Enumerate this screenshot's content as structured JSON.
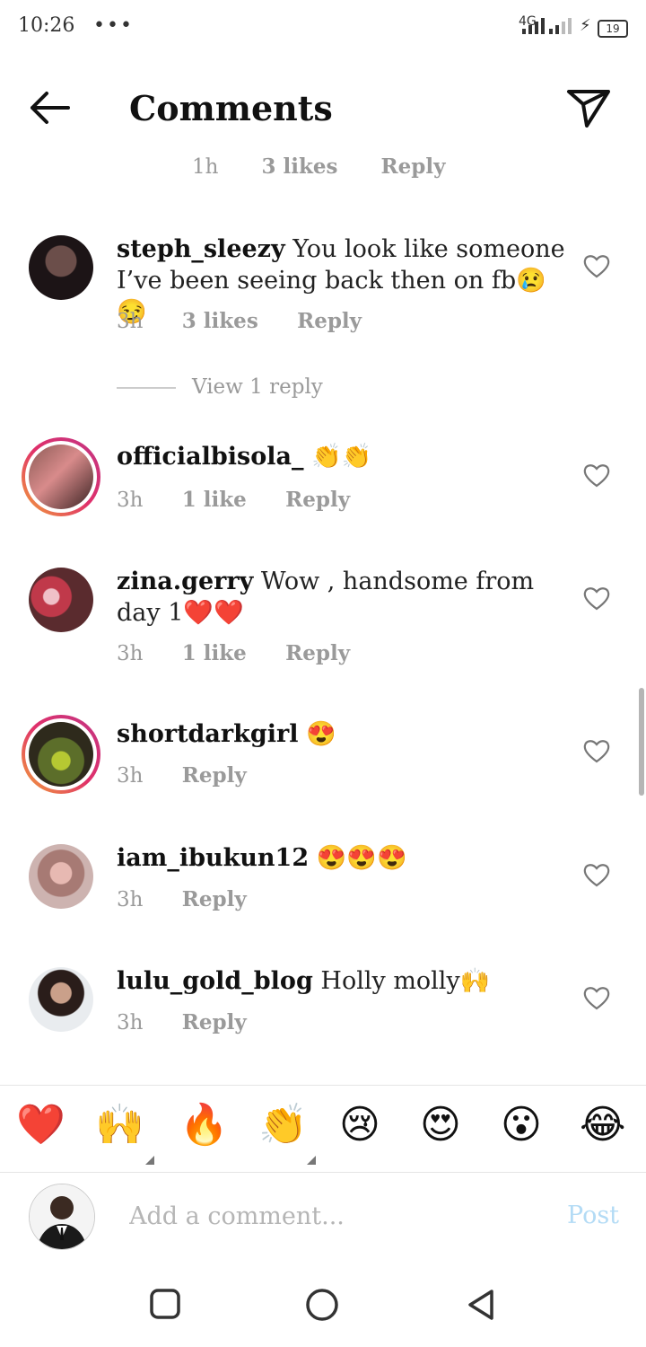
{
  "status_bar": {
    "time": "10:26",
    "dots": "•••",
    "network": "4G",
    "battery": "19"
  },
  "header": {
    "title": "Comments",
    "back_icon": "arrow-left-icon",
    "send_icon": "paper-plane-icon"
  },
  "top_meta": {
    "time": "1h",
    "likes": "3 likes",
    "reply": "Reply"
  },
  "comments": [
    {
      "username": "steph_sleezy",
      "text": " You look like someone I’ve been seeing back then on fb😢😏",
      "time": "3h",
      "likes": "3 likes",
      "reply": "Reply"
    },
    {
      "username": "officialbisola_",
      "text": " 👏👏",
      "time": "3h",
      "likes": "1 like",
      "reply": "Reply"
    },
    {
      "username": "zina.gerry",
      "text": " Wow , handsome from day 1❤️❤️",
      "time": "3h",
      "likes": "1 like",
      "reply": "Reply"
    },
    {
      "username": "shortdarkgirl",
      "text": " 😍",
      "time": "3h",
      "likes": "",
      "reply": "Reply"
    },
    {
      "username": "iam_ibukun12",
      "text": " 😍😍😍",
      "time": "3h",
      "likes": "",
      "reply": "Reply"
    },
    {
      "username": "lulu_gold_blog",
      "text": " Holly molly🙌",
      "time": "3h",
      "likes": "",
      "reply": "Reply"
    }
  ],
  "view_replies": "View 1 reply",
  "emoji_bar": [
    "❤️",
    "🙌",
    "🔥",
    "👏",
    "😢",
    "😍",
    "😮",
    "😂"
  ],
  "composer": {
    "placeholder": "Add a comment...",
    "post_label": "Post"
  },
  "colors": {
    "meta_gray": "#9a9a9a",
    "post_disabled": "#b3dbf5",
    "story_ring_start": "#f2a33a",
    "story_ring_end": "#c13584"
  }
}
